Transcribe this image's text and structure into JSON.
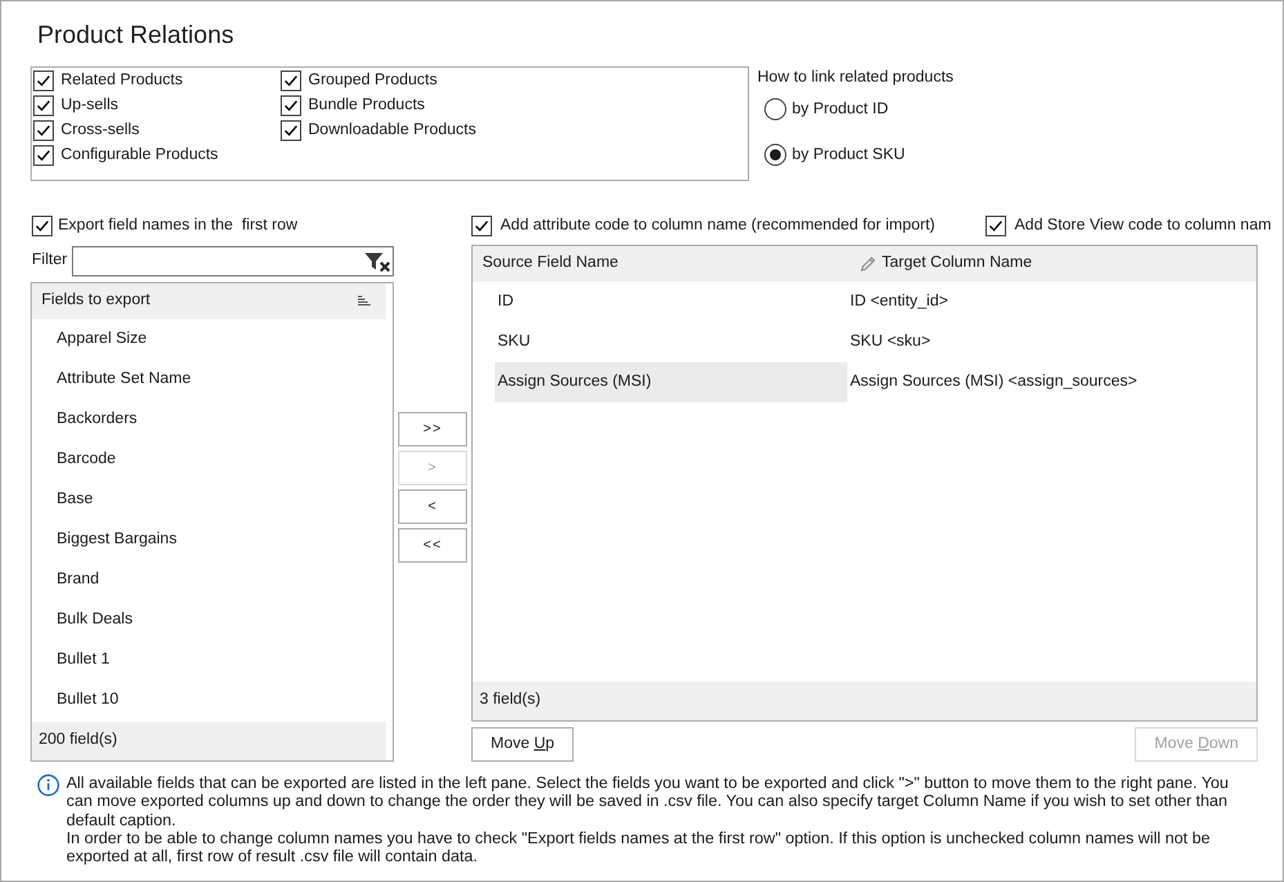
{
  "window": {
    "title": "Product Relations"
  },
  "relation_types": {
    "columns": [
      [
        {
          "label": "Related Products",
          "checked": true
        },
        {
          "label": "Up-sells",
          "checked": true
        },
        {
          "label": "Cross-sells",
          "checked": true
        },
        {
          "label": "Configurable Products",
          "checked": true
        }
      ],
      [
        {
          "label": "Grouped Products",
          "checked": true
        },
        {
          "label": "Bundle Products",
          "checked": true
        },
        {
          "label": "Downloadable Products",
          "checked": true
        }
      ]
    ]
  },
  "link_method": {
    "label": "How to link related products",
    "options": [
      {
        "label": "by Product ID",
        "selected": false
      },
      {
        "label": "by Product SKU",
        "selected": true
      }
    ]
  },
  "export_field_names": {
    "label": "Export field names in the  first row",
    "checked": true
  },
  "filter": {
    "label": "Filter"
  },
  "fields_list": {
    "header": "Fields to export",
    "items": [
      {
        "label": "Apparel Size",
        "selected": false
      },
      {
        "label": "Attribute Set Name",
        "selected": false
      },
      {
        "label": "Backorders",
        "selected": false
      },
      {
        "label": "Barcode",
        "selected": false
      },
      {
        "label": "Base",
        "selected": false
      },
      {
        "label": "Biggest Bargains",
        "selected": false
      },
      {
        "label": "Brand",
        "selected": false
      },
      {
        "label": "Bulk Deals",
        "selected": false
      },
      {
        "label": "Bullet 1",
        "selected": false
      },
      {
        "label": "Bullet 10",
        "selected": false
      }
    ],
    "footer": "200 field(s)"
  },
  "transfer_buttons": [
    {
      "label": ">>",
      "disabled": false
    },
    {
      "label": ">",
      "disabled": true
    },
    {
      "label": "<",
      "disabled": false
    },
    {
      "label": "<<",
      "disabled": false
    }
  ],
  "attribute_code_option": {
    "label": "Add attribute code to column name (recommended for import)",
    "checked": true
  },
  "store_view_option": {
    "label": "Add Store View code to column nam",
    "checked": true
  },
  "mapping_table": {
    "columns": [
      {
        "label": "Source Field Name",
        "editable": false
      },
      {
        "label": "Target Column Name",
        "editable": true
      }
    ],
    "rows": [
      {
        "source": "ID",
        "target": "ID <entity_id>",
        "selected": false
      },
      {
        "source": "SKU",
        "target": "SKU <sku>",
        "selected": false
      },
      {
        "source": "Assign Sources (MSI)",
        "target": "Assign Sources (MSI) <assign_sources>",
        "selected": true
      }
    ],
    "footer": "3 field(s)"
  },
  "move_buttons": [
    {
      "label": {
        "before": "Move ",
        "key": "U",
        "after": "p"
      },
      "disabled": false
    },
    {
      "label": {
        "before": "Move ",
        "key": "D",
        "after": "own"
      },
      "disabled": true
    }
  ],
  "info": {
    "paragraphs": [
      "All available fields that can be exported are listed in the left pane. Select the fields you want to be exported and click \">\" button to move them to the right pane. You can move exported columns up and down to change the order they will be saved in .csv file. You can also specify target Column Name if you wish to set other than default caption.",
      "In order to be able to change column names you have to check \"Export fields names at the first row\" option. If this option is unchecked column names will not be exported at all, first row of result .csv file will contain data."
    ]
  }
}
